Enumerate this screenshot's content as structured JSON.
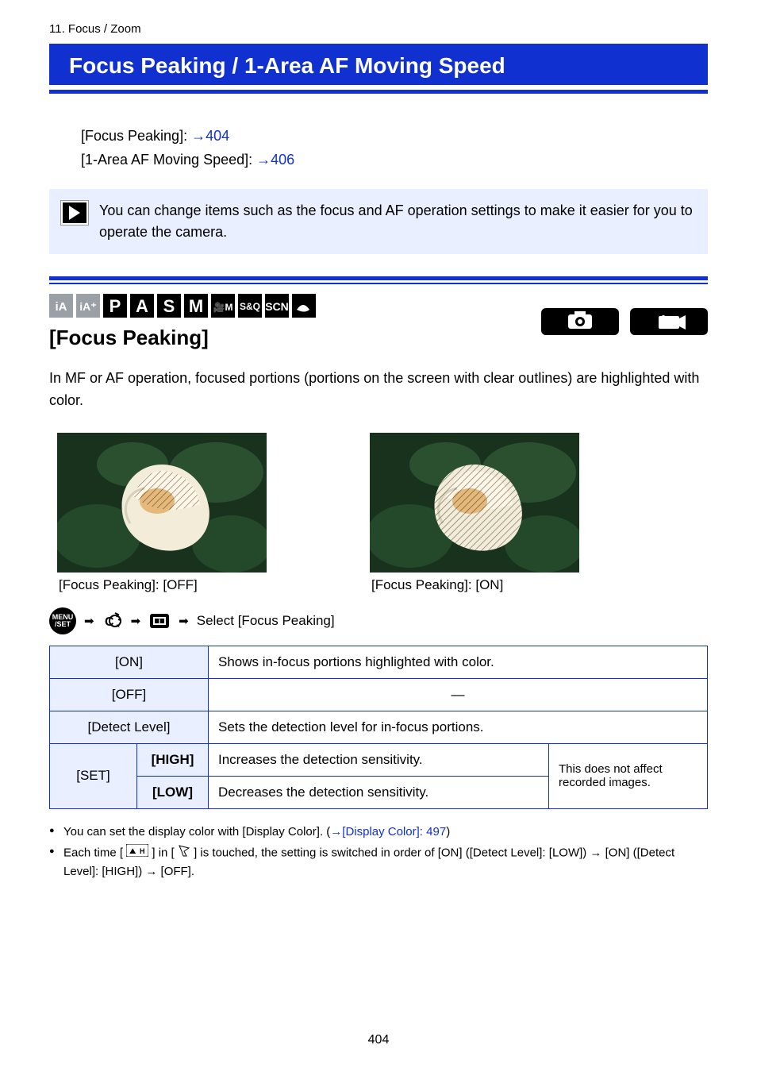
{
  "breadcrumb": "11. Focus / Zoom",
  "page_title": "Focus Peaking / 1-Area AF Moving Speed",
  "nav": {
    "item1_label": "[Focus Peaking]: ",
    "item1_ref": "404",
    "item2_label": "[1-Area AF Moving Speed]: ",
    "item2_ref": "406"
  },
  "tip": "You can change items such as the focus and AF operation settings to make it easier for you to operate the camera.",
  "section": {
    "title": "[Focus Peaking]",
    "intro": "In MF or AF operation, focused portions (portions on the screen with clear outlines) are highlighted with color."
  },
  "samples": {
    "off_caption": "[Focus Peaking]: [OFF]",
    "on_caption": "[Focus Peaking]: [ON]"
  },
  "menu_path": {
    "trail_label": "Select [Focus Peaking]"
  },
  "table": {
    "r1_label": "[ON]",
    "r1_desc": "Shows in-focus portions highlighted with color.",
    "r2_label": "[OFF]",
    "r2_desc": "—",
    "r3_label": "[Detect Level]",
    "r3_desc": "Sets the detection level for in-focus portions.",
    "r4_label": "[SET]",
    "r4a_sub": "[HIGH]",
    "r4a_desc": "Increases the detection sensitivity.",
    "r4_note": "This does not affect recorded images.",
    "r4b_sub": "[LOW]",
    "r4b_desc": "Decreases the detection sensitivity."
  },
  "notes": {
    "n1": "You can set the display color with [Display Color]. (",
    "n1_ref": "[Display Color]: 497",
    "n1_tail": ")",
    "n2_a": "Each time [ ",
    "n2_b": " ] in [ ",
    "n2_c": " ] is touched, the setting is switched in order of [ON] ([Detect Level]: [LOW]) → [ON] ([Detect Level]: [HIGH]) → [OFF]."
  },
  "page_number": "404"
}
